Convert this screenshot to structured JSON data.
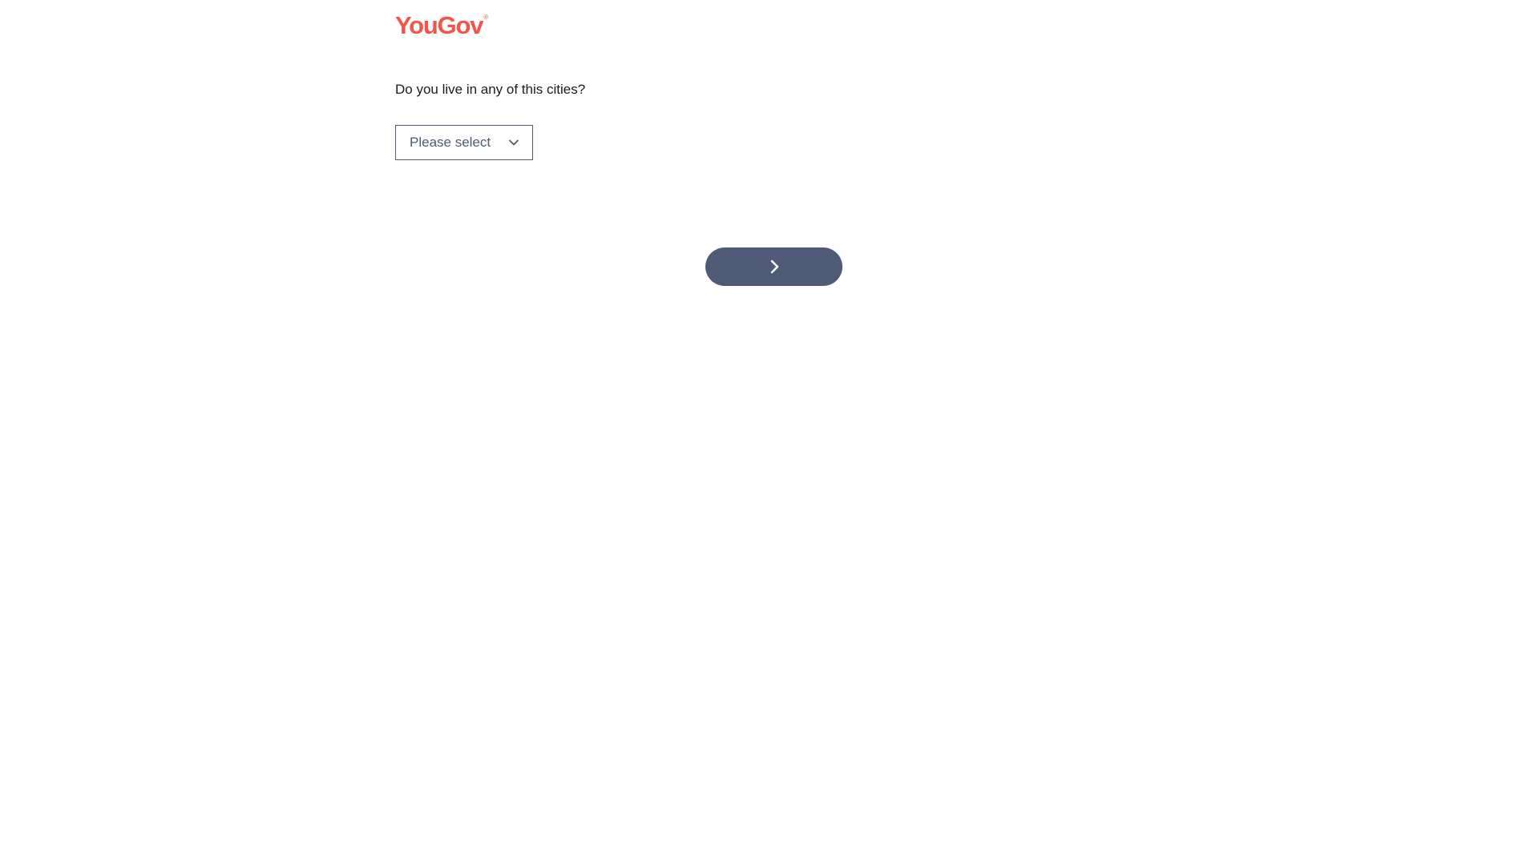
{
  "brand": {
    "logo_text": "YouGov",
    "logo_mark": "®",
    "logo_color": "#f0564a"
  },
  "question": {
    "text": "Do you live in any of this cities?"
  },
  "city_select": {
    "placeholder": "Please select",
    "icon": "chevron-down-icon"
  },
  "navigation": {
    "next_icon": "chevron-right-icon",
    "button_color": "#4e5a76"
  }
}
